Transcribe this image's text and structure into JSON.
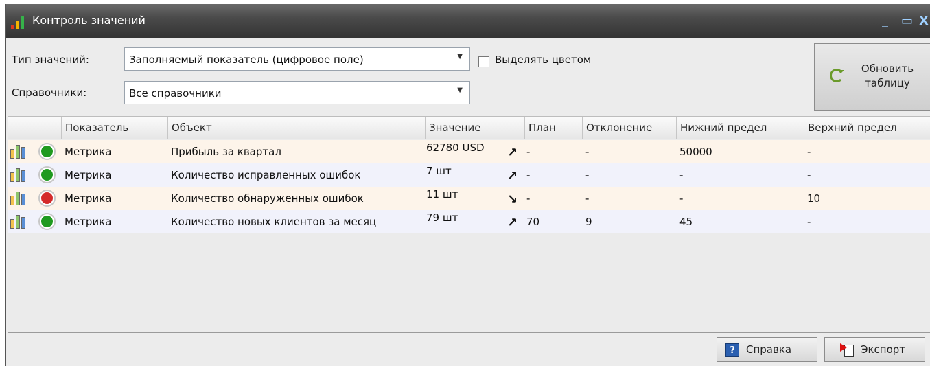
{
  "window": {
    "title": "Контроль значений",
    "min_glyph": "_",
    "max_glyph": "▭",
    "close_glyph": "X"
  },
  "filters": {
    "type_label": "Тип значений:",
    "type_value": "Заполняемый показатель (цифровое поле)",
    "refs_label": "Справочники:",
    "refs_value": "Все справочники",
    "highlight_label": "Выделять цветом",
    "highlight_checked": false
  },
  "refresh_button": {
    "line1": "Обновить",
    "line2": "таблицу"
  },
  "grid": {
    "columns": [
      "Показатель",
      "Объект",
      "Значение",
      "План",
      "Отклонение",
      "Нижний предел",
      "Верхний предел"
    ],
    "rows": [
      {
        "indicator": "Метрика",
        "object": "Прибыль за квартал",
        "value": "62780 USD",
        "trend": "↗",
        "plan": "-",
        "deviation": "-",
        "lower": "50000",
        "upper": "-",
        "status": "green"
      },
      {
        "indicator": "Метрика",
        "object": "Количество исправленных ошибок",
        "value": "7 шт",
        "trend": "↗",
        "plan": "-",
        "deviation": "-",
        "lower": "-",
        "upper": "-",
        "status": "green"
      },
      {
        "indicator": "Метрика",
        "object": "Количество обнаруженных ошибок",
        "value": "11 шт",
        "trend": "↘",
        "plan": "-",
        "deviation": "-",
        "lower": "-",
        "upper": "10",
        "status": "red"
      },
      {
        "indicator": "Метрика",
        "object": "Количество новых клиентов за месяц",
        "value": "79 шт",
        "trend": "↗",
        "plan": "70",
        "deviation": "9",
        "lower": "45",
        "upper": "-",
        "status": "green"
      }
    ]
  },
  "colors": {
    "green": "#1f9a1f",
    "red": "#d42a2a"
  },
  "footer": {
    "help_label": "Справка",
    "help_glyph": "?",
    "export_label": "Экспорт"
  }
}
